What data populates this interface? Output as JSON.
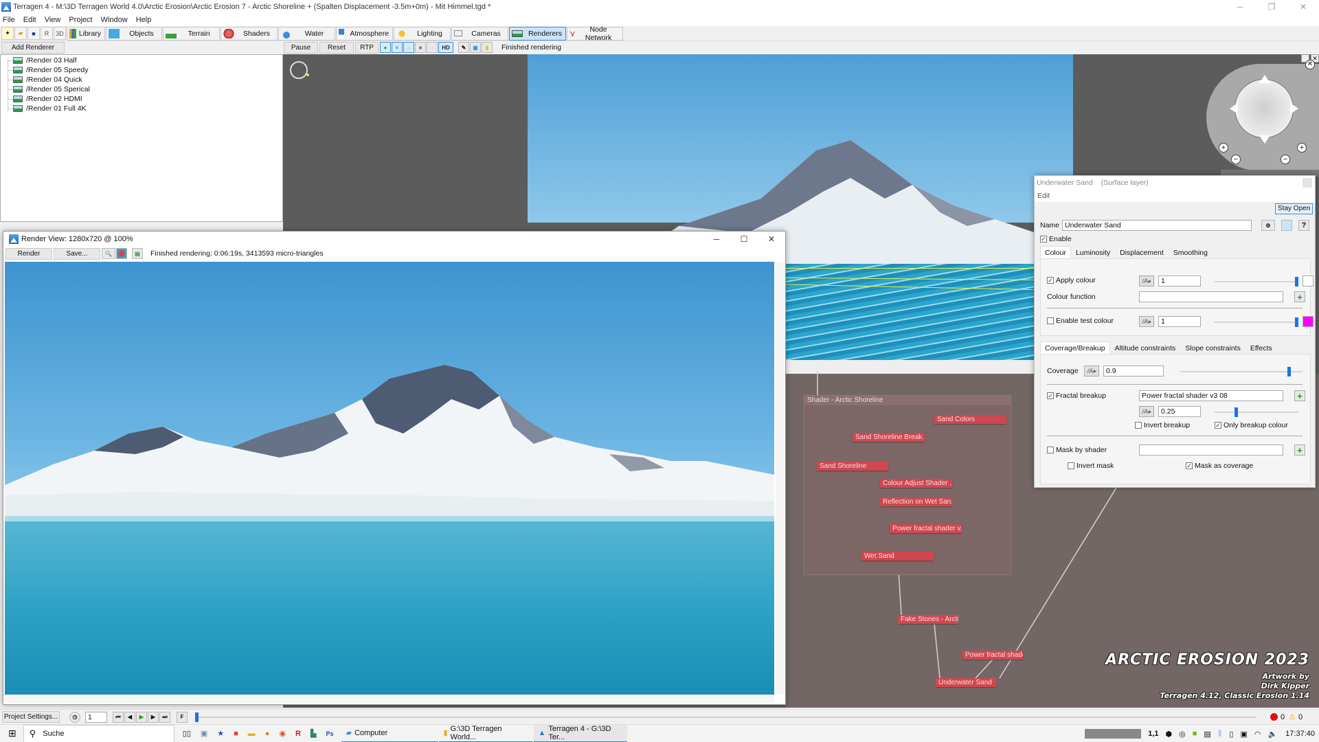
{
  "window": {
    "title": "Terragen 4 - M:\\3D Terragen World 4.0\\Arctic Erosion\\Arctic Erosion 7 - Arctic Shoreline + (Spalten Displacement -3.5m+0m) - Mit Himmel.tgd *",
    "controls": {
      "minimize": "─",
      "restore": "❐",
      "close": "✕"
    }
  },
  "menu": [
    "File",
    "Edit",
    "View",
    "Project",
    "Window",
    "Help"
  ],
  "toolbar": {
    "small_icons": [
      "new-icon",
      "open-icon",
      "save-icon",
      "render-icon",
      "3d-icon"
    ],
    "buttons": [
      {
        "label": "Library",
        "icon": "library-icon"
      },
      {
        "label": "Objects",
        "icon": "objects-icon"
      },
      {
        "label": "Terrain",
        "icon": "terrain-icon"
      },
      {
        "label": "Shaders",
        "icon": "shaders-icon"
      },
      {
        "label": "Water",
        "icon": "water-icon"
      },
      {
        "label": "Atmosphere",
        "icon": "atmosphere-icon"
      },
      {
        "label": "Lighting",
        "icon": "lighting-icon"
      },
      {
        "label": "Cameras",
        "icon": "cameras-icon"
      },
      {
        "label": "Renderers",
        "icon": "renderers-icon",
        "active": true
      },
      {
        "label": "Node Network",
        "icon": "node-network-icon"
      }
    ]
  },
  "subtoolbar": {
    "add_renderer": "Add Renderer",
    "pause": "Pause",
    "reset": "Reset",
    "rtp": "RTP",
    "hd": "HD",
    "status": "Finished rendering"
  },
  "renderers": [
    "/Render 03 Half",
    "/Render 05 Speedy",
    "/Render 04 Quick",
    "/Render 05 Sperical",
    "/Render 02 HDMI",
    "/Render 01 Full 4K"
  ],
  "render_view": {
    "title": "Render View: 1280x720 @ 100%",
    "render_button": "Render",
    "save_button": "Save...",
    "status": "Finished rendering:  0:06:19s, 3413593 micro-triangles",
    "controls": {
      "minimize": "─",
      "maximize": "☐",
      "close": "✕"
    }
  },
  "node_network": {
    "group_title": "Shader - Arctic Shoreline",
    "nodes": [
      "Sand Colors",
      "Sand Shoreline Break...",
      "Sand Shoreline",
      "Colour Adjust Shader ...",
      "Reflection on Wet San...",
      "Power fractal shader v...",
      "Wet Sand",
      "Fake Stones - Arctic ...",
      "Power fractal shader v...",
      "Underwater Sand"
    ]
  },
  "watermark": {
    "title": "ARCTIC EROSION 2023",
    "line1": "Artwork by",
    "line2": "Dirk Kipper",
    "line3": "Terragen 4.12, Classic Erosion 1.14"
  },
  "dialog": {
    "title": "Underwater Sand",
    "subtitle": "(Surface layer)",
    "menu_edit": "Edit",
    "stay_open": "Stay Open",
    "name_label": "Name",
    "name_value": "Underwater Sand",
    "enable_label": "Enable",
    "enable_checked": true,
    "tabs": [
      "Colour",
      "Luminosity",
      "Displacement",
      "Smoothing"
    ],
    "active_tab": "Colour",
    "apply_colour": {
      "label": "Apply colour",
      "checked": true,
      "value": "1",
      "slider": 1.0,
      "swatch": "#ffffff"
    },
    "colour_function": {
      "label": "Colour function",
      "value": ""
    },
    "test_colour": {
      "label": "Enable test colour",
      "checked": false,
      "value": "1",
      "slider": 1.0,
      "swatch": "#ff00ff"
    },
    "lower_tabs": [
      "Coverage/Breakup",
      "Altitude constraints",
      "Slope constraints",
      "Effects"
    ],
    "lower_active_tab": "Coverage/Breakup",
    "coverage": {
      "label": "Coverage",
      "value": "0.9",
      "slider": 0.9
    },
    "fractal_breakup": {
      "label": "Fractal breakup",
      "checked": true,
      "shader": "Power fractal shader v3 08",
      "value": "0.25",
      "slider": 0.25
    },
    "invert_breakup": {
      "label": "Invert breakup",
      "checked": false
    },
    "only_breakup_colour": {
      "label": "Only breakup colour",
      "checked": true
    },
    "mask_by_shader": {
      "label": "Mask by shader",
      "checked": false,
      "value": ""
    },
    "invert_mask": {
      "label": "Invert mask",
      "checked": false
    },
    "mask_as_coverage": {
      "label": "Mask as coverage",
      "checked": true
    }
  },
  "bottombar": {
    "project_settings": "Project Settings...",
    "frame": "1",
    "errors": "0",
    "warnings": "0"
  },
  "taskbar": {
    "search_placeholder": "Suche",
    "apps": [
      "Computer",
      "G:\\3D Terragen World...",
      "Terragen 4 - G:\\3D Ter..."
    ],
    "tray_text": "1,1",
    "clock": "17:37:40"
  },
  "colors": {
    "accent": "#3c8dd8",
    "node": "#d0474f",
    "node_bg": "#736766",
    "sky": "#4e9fd6",
    "water": "#2aa6cc"
  }
}
